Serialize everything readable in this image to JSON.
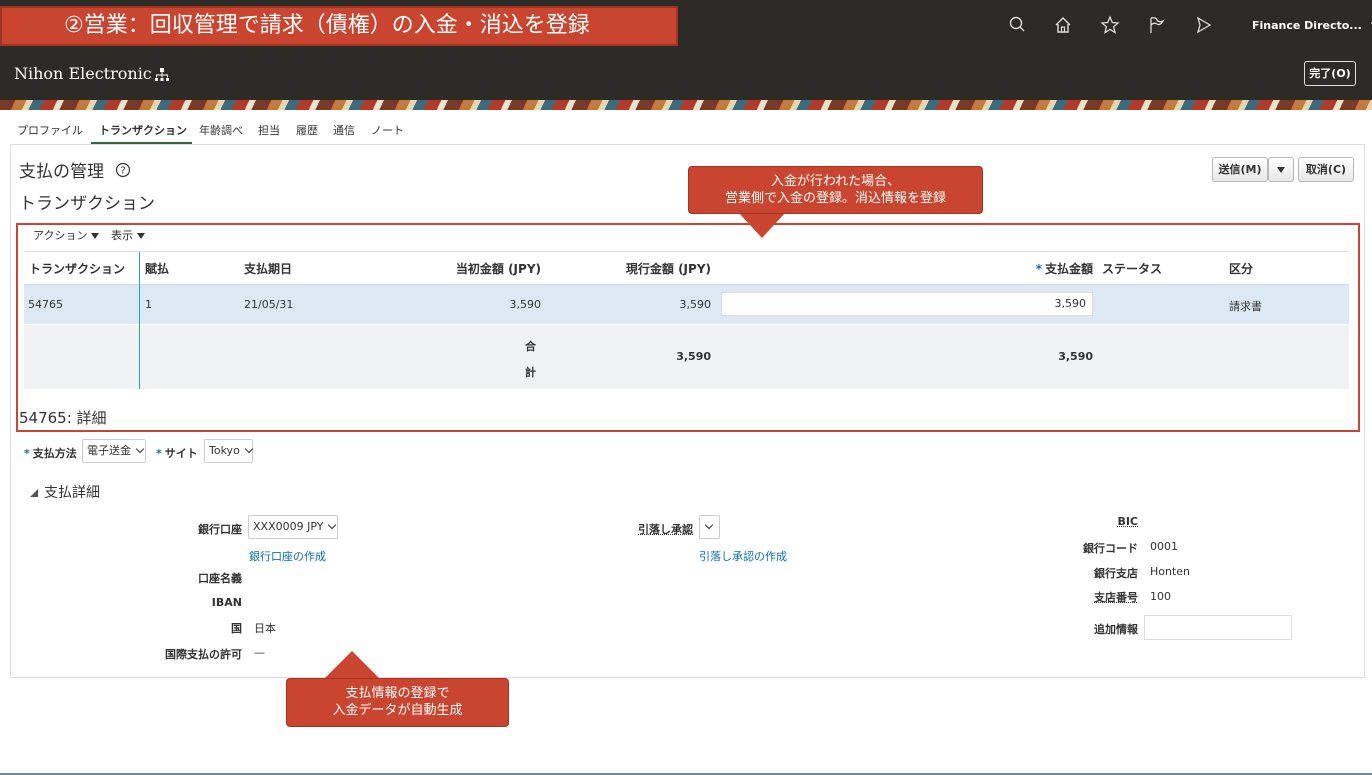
{
  "header": {
    "callout_title": "②営業：回収管理で請求（債権）の入金・消込を登録",
    "company_name": "Nihon Electronic",
    "user_menu": "Finance Directo...",
    "done_button": "完了(O)",
    "icons": [
      "search-icon",
      "home-icon",
      "star-icon",
      "flag-icon",
      "notifications-icon",
      "org-chart-icon"
    ]
  },
  "tabs": [
    "プロファイル",
    "トランザクション",
    "年齢調べ",
    "担当",
    "履歴",
    "通信",
    "ノート"
  ],
  "active_tab": "トランザクション",
  "page": {
    "title": "支払の管理",
    "section_title": "トランザクション",
    "submit_button": "送信(M)",
    "cancel_button": "取消(C)"
  },
  "table": {
    "actions_menu": "アクション",
    "view_menu": "表示",
    "columns": [
      "トランザクション",
      "賦払",
      "支払期日",
      "当初金額 (JPY)",
      "現行金額 (JPY)",
      "支払金額",
      "ステータス",
      "区分"
    ],
    "rows": [
      {
        "transaction": "54765",
        "installment": "1",
        "due_date": "21/05/31",
        "original_amount": "3,590",
        "current_amount": "3,590",
        "payment_amount": "3,590",
        "status": "",
        "class": "請求書"
      }
    ],
    "total": {
      "label_1": "合",
      "label_2": "計",
      "current_amount": "3,590",
      "payment_amount": "3,590"
    }
  },
  "detail": {
    "title": "54765: 詳細",
    "payment_method_label": "支払方法",
    "payment_method_value": "電子送金",
    "site_label": "サイト",
    "site_value": "Tokyo",
    "section": "支払詳細",
    "bank_account_label": "銀行口座",
    "bank_account_value": "XXX0009 JPY",
    "create_bank_account_link": "銀行口座の作成",
    "account_holder_label": "口座名義",
    "iban_label": "IBAN",
    "country_label": "国",
    "country_value": "日本",
    "intl_payment_label": "国際支払の許可",
    "intl_payment_value": "—",
    "debit_authorization_label": "引落し承認",
    "create_debit_authorization_link": "引落し承認の作成",
    "bic_label": "BIC",
    "bank_code_label": "銀行コード",
    "bank_code_value": "0001",
    "bank_branch_label": "銀行支店",
    "bank_branch_value": "Honten",
    "branch_number_label": "支店番号",
    "branch_number_value": "100",
    "additional_info_label": "追加情報"
  },
  "callouts": {
    "top_line1": "入金が行われた場合、",
    "top_line2": "営業側で入金の登録。消込情報を登録",
    "bottom_line1": "支払情報の登録で",
    "bottom_line2": "入金データが自動生成"
  },
  "colors": {
    "header_bg": "#2d2b28",
    "callout": "#c9452f",
    "selected_row": "#dce9f5",
    "link": "#0b6fb0"
  }
}
